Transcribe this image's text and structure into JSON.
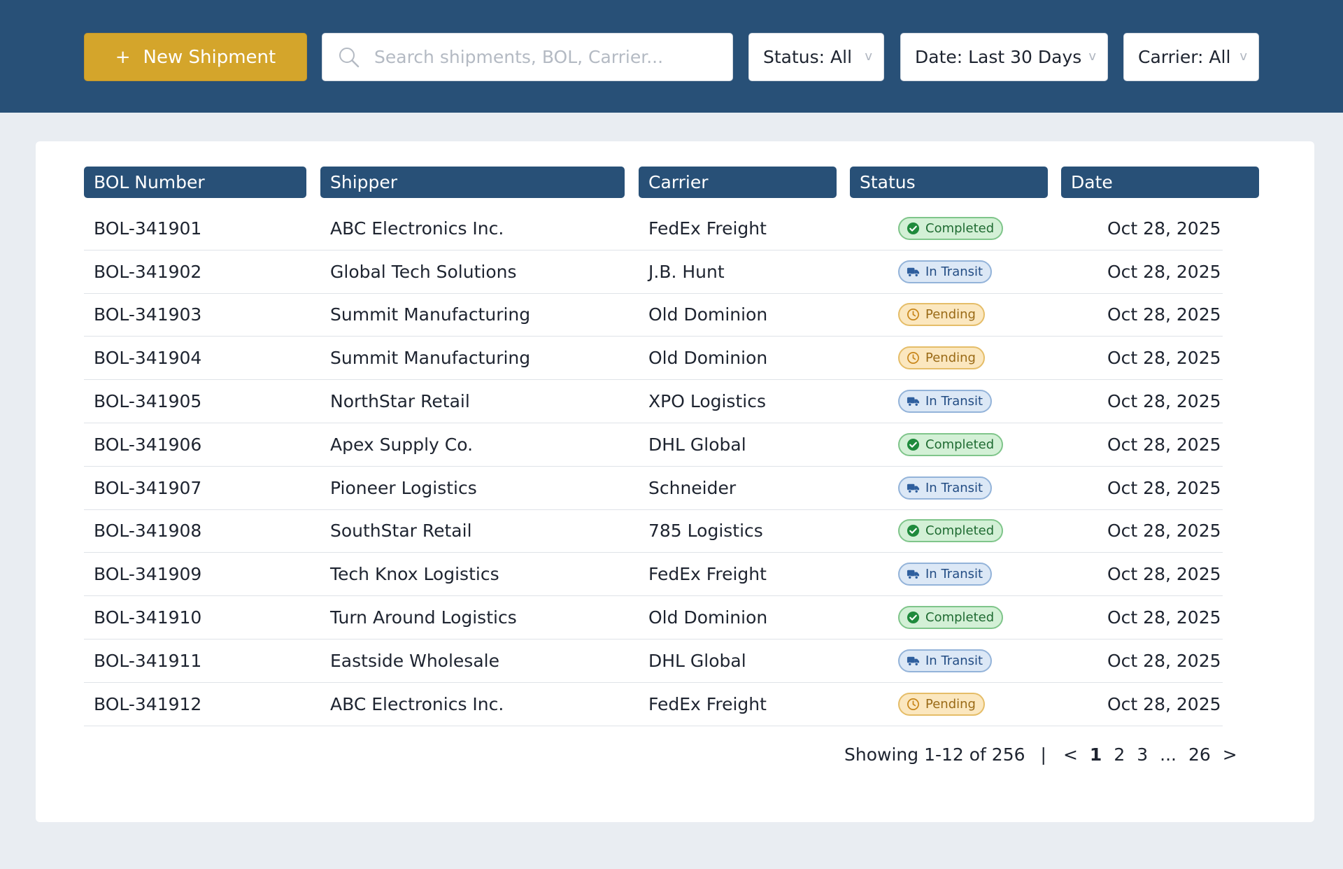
{
  "toolbar": {
    "new_shipment_label": "New Shipment",
    "new_shipment_icon": "+",
    "search_placeholder": "Search shipments, BOL, Carrier...",
    "status_filter": "Status: All",
    "date_filter": "Date: Last 30 Days",
    "carrier_filter": "Carrier: All",
    "chevron": "v"
  },
  "table": {
    "headers": [
      "BOL Number",
      "Shipper",
      "Carrier",
      "Status",
      "Date"
    ],
    "rows": [
      {
        "bol": "BOL-341901",
        "shipper": "ABC Electronics Inc.",
        "carrier": "FedEx Freight",
        "status": "Completed",
        "status_type": "completed",
        "date": "Oct 28, 2025"
      },
      {
        "bol": "BOL-341902",
        "shipper": "Global Tech Solutions",
        "carrier": "J.B. Hunt",
        "status": "In Transit",
        "status_type": "transit",
        "date": "Oct 28, 2025"
      },
      {
        "bol": "BOL-341903",
        "shipper": "Summit Manufacturing",
        "carrier": "Old Dominion",
        "status": "Pending",
        "status_type": "pending",
        "date": "Oct 28, 2025"
      },
      {
        "bol": "BOL-341904",
        "shipper": "Summit Manufacturing",
        "carrier": "Old Dominion",
        "status": "Pending",
        "status_type": "pending",
        "date": "Oct 28, 2025"
      },
      {
        "bol": "BOL-341905",
        "shipper": "NorthStar Retail",
        "carrier": "XPO Logistics",
        "status": "In Transit",
        "status_type": "transit",
        "date": "Oct 28, 2025"
      },
      {
        "bol": "BOL-341906",
        "shipper": "Apex Supply Co.",
        "carrier": "DHL Global",
        "status": "Completed",
        "status_type": "completed",
        "date": "Oct 28, 2025"
      },
      {
        "bol": "BOL-341907",
        "shipper": "Pioneer Logistics",
        "carrier": "Schneider",
        "status": "In Transit",
        "status_type": "transit",
        "date": "Oct 28, 2025"
      },
      {
        "bol": "BOL-341908",
        "shipper": "SouthStar Retail",
        "carrier": "785 Logistics",
        "status": "Completed",
        "status_type": "completed",
        "date": "Oct 28, 2025"
      },
      {
        "bol": "BOL-341909",
        "shipper": "Tech Knox Logistics",
        "carrier": "FedEx Freight",
        "status": "In Transit",
        "status_type": "transit",
        "date": "Oct 28, 2025"
      },
      {
        "bol": "BOL-341910",
        "shipper": "Turn Around Logistics",
        "carrier": "Old Dominion",
        "status": "Completed",
        "status_type": "completed",
        "date": "Oct 28, 2025"
      },
      {
        "bol": "BOL-341911",
        "shipper": "Eastside Wholesale",
        "carrier": "DHL Global",
        "status": "In Transit",
        "status_type": "transit",
        "date": "Oct 28, 2025"
      },
      {
        "bol": "BOL-341912",
        "shipper": "ABC Electronics Inc.",
        "carrier": "FedEx Freight",
        "status": "Pending",
        "status_type": "pending",
        "date": "Oct 28, 2025"
      }
    ]
  },
  "pagination": {
    "showing": "Showing 1-12 of 256",
    "separator": "|",
    "prev": "<",
    "pages": [
      "1",
      "2",
      "3",
      "...",
      "26"
    ],
    "current": "1",
    "next": ">"
  },
  "colors": {
    "header_blue": "#285077",
    "accent_gold": "#d4a52b",
    "completed": "#2e9e4a",
    "in_transit": "#2f5f9e",
    "pending": "#d69a2a"
  },
  "icons": {
    "search": "search-icon",
    "completed": "check-circle-icon",
    "in_transit": "truck-icon",
    "pending": "clock-icon"
  }
}
